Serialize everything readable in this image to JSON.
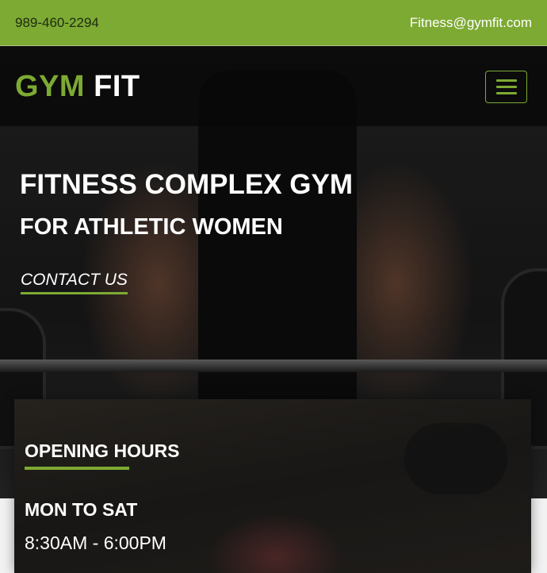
{
  "topbar": {
    "phone": "989-460-2294",
    "email": "Fitness@gymfit.com"
  },
  "navbar": {
    "logo_part1": "GYM",
    "logo_part2": "FIT",
    "menu_icon": "hamburger-menu-icon"
  },
  "hero": {
    "title": "FITNESS COMPLEX GYM",
    "subtitle": "FOR ATHLETIC WOMEN",
    "cta": "CONTACT US"
  },
  "hours": {
    "title": "OPENING HOURS",
    "days": "MON TO SAT",
    "time": "8:30AM - 6:00PM"
  },
  "colors": {
    "accent": "#7daa33",
    "nav_bg": "#080808",
    "text_light": "#ffffff",
    "text_dark": "#1e2a10"
  }
}
